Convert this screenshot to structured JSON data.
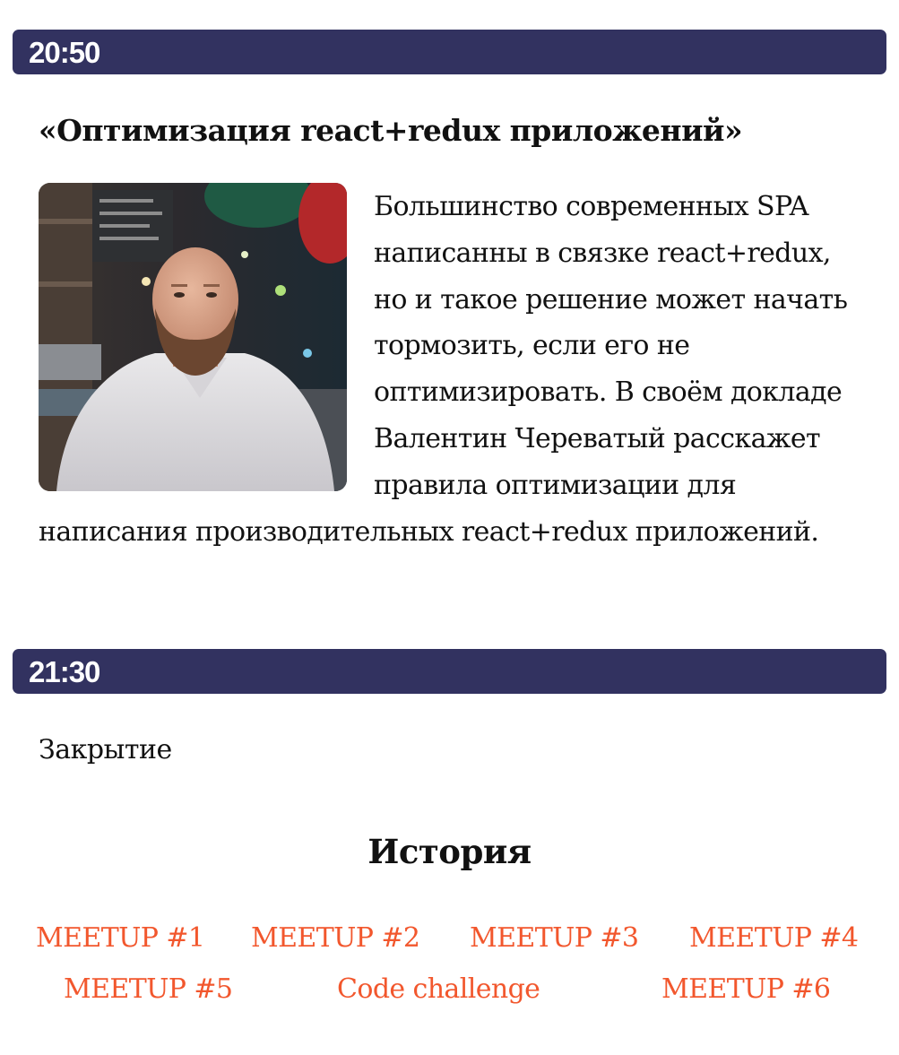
{
  "schedule": [
    {
      "time": "20:50",
      "title": "«Оптимизация react+redux приложений»",
      "description": "Большинство современных SPA написанны в связке react+redux, но и такое реше­ние может начать тормозить, если его не оптимизировать. В своём докладе Валентин Че­ре­ва­тый расскажет правила оптимизации для написания производительных react+redux приложений."
    },
    {
      "time": "21:30",
      "text": "Закрытие"
    }
  ],
  "history": {
    "heading": "История",
    "links": [
      "MEETUP #1",
      "MEETUP #2",
      "MEETUP #3",
      "MEETUP #4",
      "MEETUP #5",
      "Code challenge",
      "MEETUP #6"
    ]
  },
  "colors": {
    "time_bar": "#323260",
    "link": "#f2572d",
    "text": "#111111"
  }
}
